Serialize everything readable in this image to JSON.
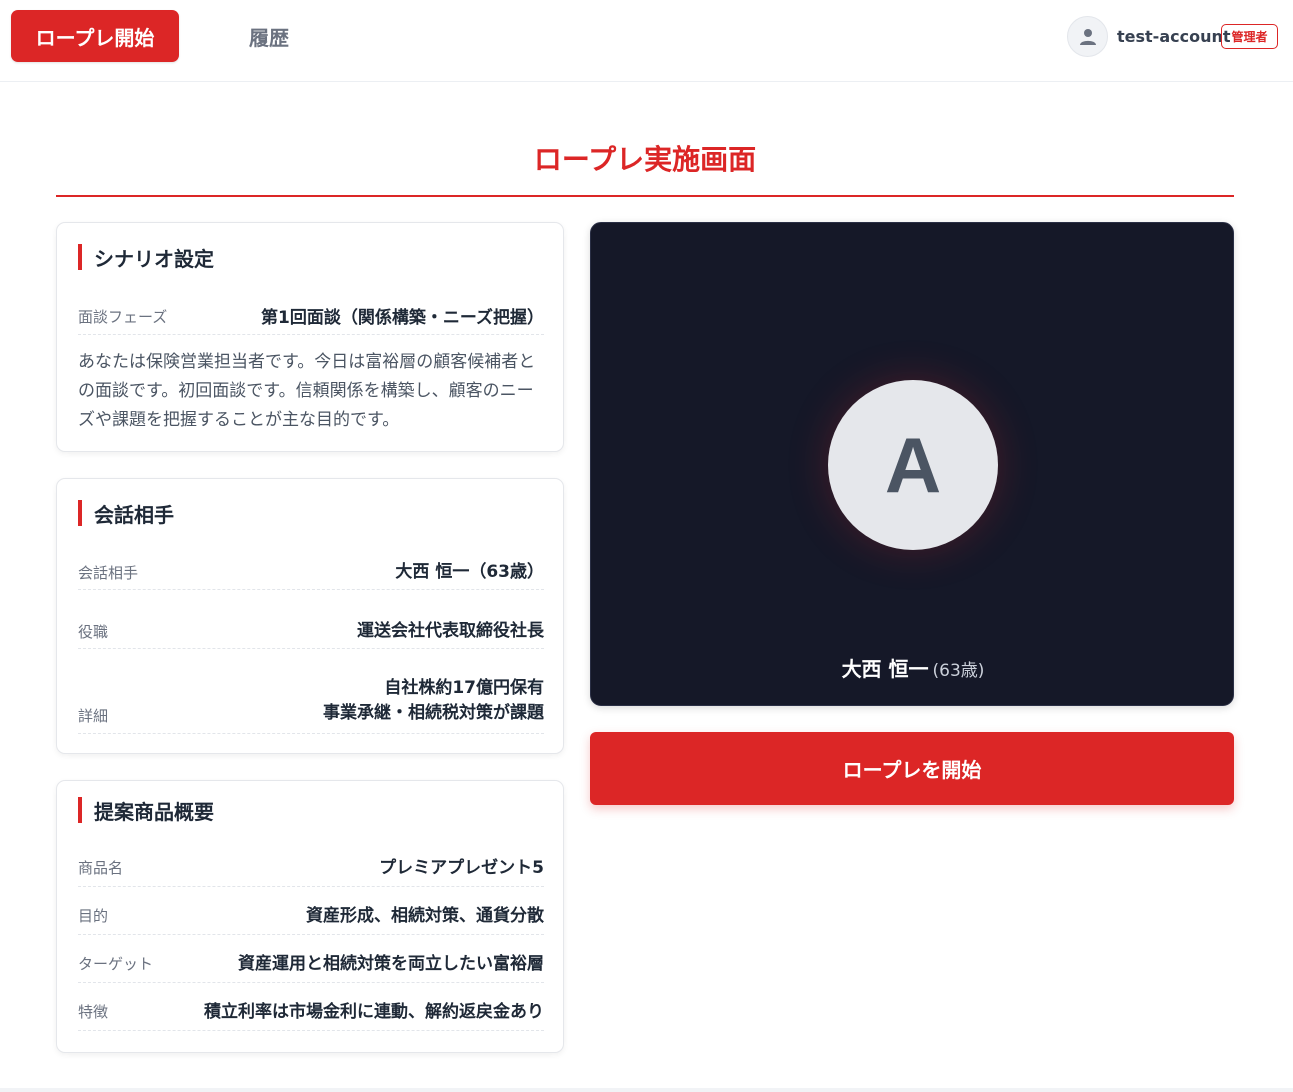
{
  "nav": {
    "start_label": "ロープレ開始",
    "history_label": "履歴"
  },
  "user": {
    "icon": "user-icon",
    "name": "test-account",
    "role": "管理者"
  },
  "page": {
    "title": "ロープレ実施画面"
  },
  "scenario": {
    "title": "シナリオ設定",
    "phase_label": "面談フェーズ",
    "phase_value": "第1回面談（関係構築・ニーズ把握）",
    "description": "あなたは保険営業担当者です。今日は富裕層の顧客候補者との面談です。初回面談です。信頼関係を構築し、顧客のニーズや課題を把握することが主な目的です。"
  },
  "partner": {
    "title": "会話相手",
    "rows": [
      {
        "label": "会話相手",
        "value": "大西 恒一（63歳）"
      },
      {
        "label": "役職",
        "value": "運送会社代表取締役社長"
      },
      {
        "label": "詳細",
        "value_line1": "自社株約17億円保有",
        "value_line2": "事業承継・相続税対策が課題"
      }
    ]
  },
  "product": {
    "title": "提案商品概要",
    "rows": [
      {
        "label": "商品名",
        "value": "プレミアプレゼント5"
      },
      {
        "label": "目的",
        "value": "資産形成、相続対策、通貨分散"
      },
      {
        "label": "ターゲット",
        "value": "資産運用と相続対策を両立したい富裕層"
      },
      {
        "label": "特徴",
        "value": "積立利率は市場金利に連動、解約返戻金あり"
      }
    ]
  },
  "video": {
    "avatar_letter": "A",
    "name": "大西 恒一",
    "age": "(63歳)"
  },
  "start_button_label": "ロープレを開始",
  "colors": {
    "accent": "#dc2626",
    "video_bg": "#151828"
  }
}
